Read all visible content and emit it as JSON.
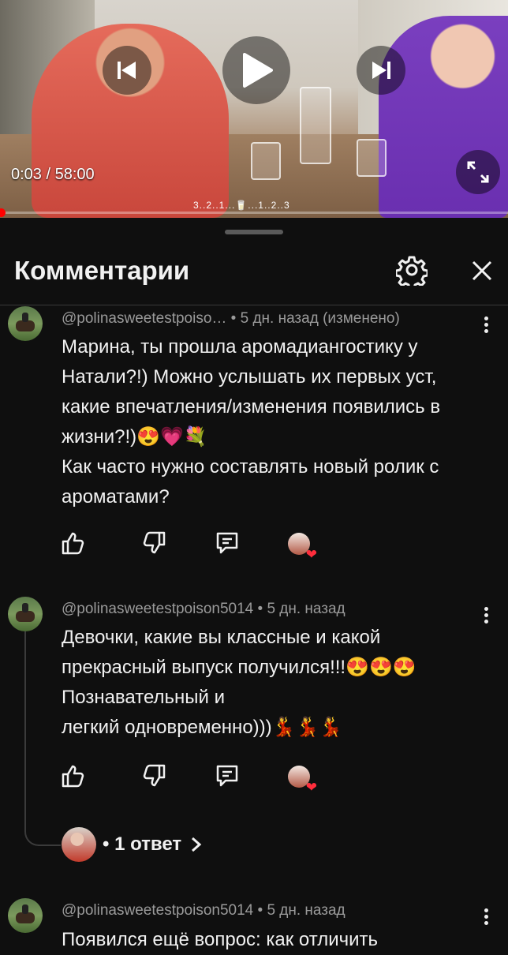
{
  "player": {
    "time_display": "0:03 / 58:00",
    "chapters_label": "3..2..1...🥛...1..2..3",
    "progress_fraction": 0.002
  },
  "panel": {
    "title": "Комментарии"
  },
  "comments": [
    {
      "meta": "@polinasweetestpoiso… • 5 дн. назад (изменено)",
      "text": "Марина, ты прошла аромадиангостику у Натали?!) Можно услышать их первых уст, какие впечатления/изменения появились в жизни?!)😍💗💐\nКак часто нужно составлять новый ролик с ароматами?"
    },
    {
      "meta": "@polinasweetestpoison5014 • 5 дн. назад",
      "text": "Девочки, какие вы классные и какой прекрасный выпуск получился!!!😍😍😍\nПознавательный и\nлегкий одновременно)))💃💃💃",
      "replies_label": "• 1 ответ"
    },
    {
      "meta": "@polinasweetestpoison5014 • 5 дн. назад",
      "text": "Появился ещё вопрос: как отличить"
    }
  ],
  "icons": {
    "like": "thumbs-up-icon",
    "dislike": "thumbs-down-icon",
    "reply": "reply-icon",
    "settings": "gear-icon",
    "close": "close-icon"
  }
}
